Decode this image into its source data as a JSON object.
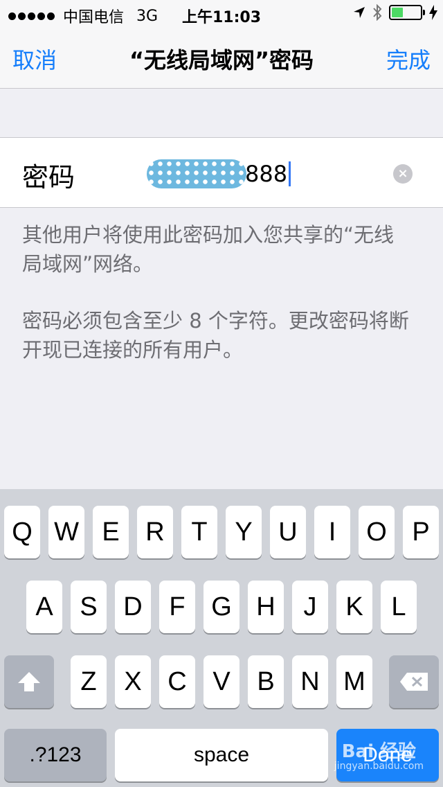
{
  "status_bar": {
    "carrier": "中国电信",
    "network": "3G",
    "time": "上午11:03",
    "signal_bars": 5,
    "battery_level": 0.4
  },
  "nav": {
    "cancel_label": "取消",
    "title": "“无线局域网”密码",
    "done_label": "完成"
  },
  "password_field": {
    "label": "密码",
    "visible_suffix": "888",
    "clear_icon": "×"
  },
  "notes": {
    "note1": "其他用户将使用此密码加入您共享的“无线局域网”网络。",
    "note2": "密码必须包含至少 8 个字符。更改密码将断开现已连接的所有用户。"
  },
  "keyboard": {
    "row1": [
      "Q",
      "W",
      "E",
      "R",
      "T",
      "Y",
      "U",
      "I",
      "O",
      "P"
    ],
    "row2": [
      "A",
      "S",
      "D",
      "F",
      "G",
      "H",
      "J",
      "K",
      "L"
    ],
    "row3": [
      "Z",
      "X",
      "C",
      "V",
      "B",
      "N",
      "M"
    ],
    "numbers_label": ".?123",
    "space_label": "space",
    "done_label": "Done",
    "shift_icon": "shift-icon",
    "delete_icon": "delete-icon"
  },
  "watermark": {
    "brand": "Bai 经验",
    "url": "jingyan.baidu.com"
  },
  "colors": {
    "accent": "#157efb",
    "done_key": "#1a84fb",
    "keyboard_bg": "#d0d3d9",
    "battery_fill": "#4cd964"
  }
}
